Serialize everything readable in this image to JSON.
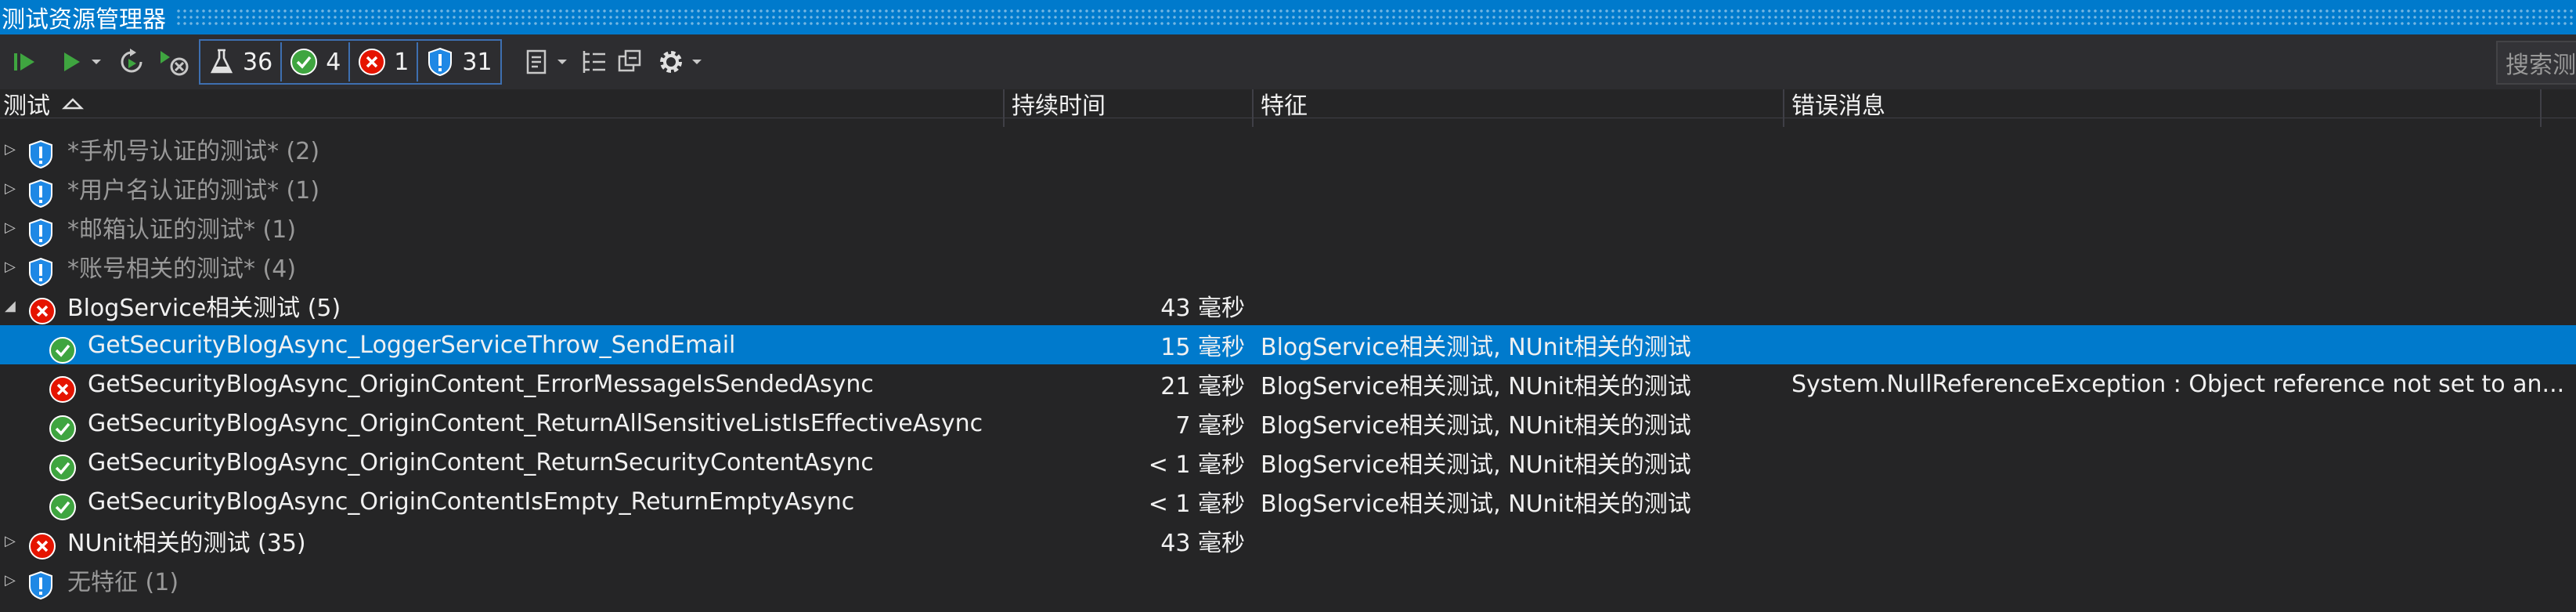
{
  "window": {
    "title": "测试资源管理器"
  },
  "toolbar": {
    "counts": {
      "total": "36",
      "passed": "4",
      "failed": "1",
      "not_run": "31"
    },
    "search_placeholder": "搜索测"
  },
  "columns": {
    "test": "测试",
    "duration": "持续时间",
    "traits": "特征",
    "error": "错误消息"
  },
  "groups_top": [
    {
      "label": "*手机号认证的测试* (2)"
    },
    {
      "label": "*用户名认证的测试* (1)"
    },
    {
      "label": "*邮箱认证的测试* (1)"
    },
    {
      "label": "*账号相关的测试* (4)"
    }
  ],
  "blog_group": {
    "label": "BlogService相关测试 (5)",
    "duration": "43 毫秒"
  },
  "tests": [
    {
      "name": "GetSecurityBlogAsync_LoggerServiceThrow_SendEmail",
      "duration": "15 毫秒",
      "traits": "BlogService相关测试, NUnit相关的测试",
      "error": "",
      "status": "passed"
    },
    {
      "name": "GetSecurityBlogAsync_OriginContent_ErrorMessageIsSendedAsync",
      "duration": "21 毫秒",
      "traits": "BlogService相关测试, NUnit相关的测试",
      "error": "System.NullReferenceException : Object reference not set to an...",
      "status": "failed"
    },
    {
      "name": "GetSecurityBlogAsync_OriginContent_ReturnAllSensitiveListIsEffectiveAsync",
      "duration": "7 毫秒",
      "traits": "BlogService相关测试, NUnit相关的测试",
      "error": "",
      "status": "passed"
    },
    {
      "name": "GetSecurityBlogAsync_OriginContent_ReturnSecurityContentAsync",
      "duration": "< 1 毫秒",
      "traits": "BlogService相关测试, NUnit相关的测试",
      "error": "",
      "status": "passed"
    },
    {
      "name": "GetSecurityBlogAsync_OriginContentIsEmpty_ReturnEmptyAsync",
      "duration": "< 1 毫秒",
      "traits": "BlogService相关测试, NUnit相关的测试",
      "error": "",
      "status": "passed"
    }
  ],
  "nunit_group": {
    "label": "NUnit相关的测试 (35)",
    "duration": "43 毫秒"
  },
  "no_trait_group": {
    "label": "无特征 (1)"
  },
  "colors": {
    "accent": "#007acc",
    "passed": "#3fa540",
    "failed": "#e51400",
    "not_run": "#1e88e5"
  }
}
